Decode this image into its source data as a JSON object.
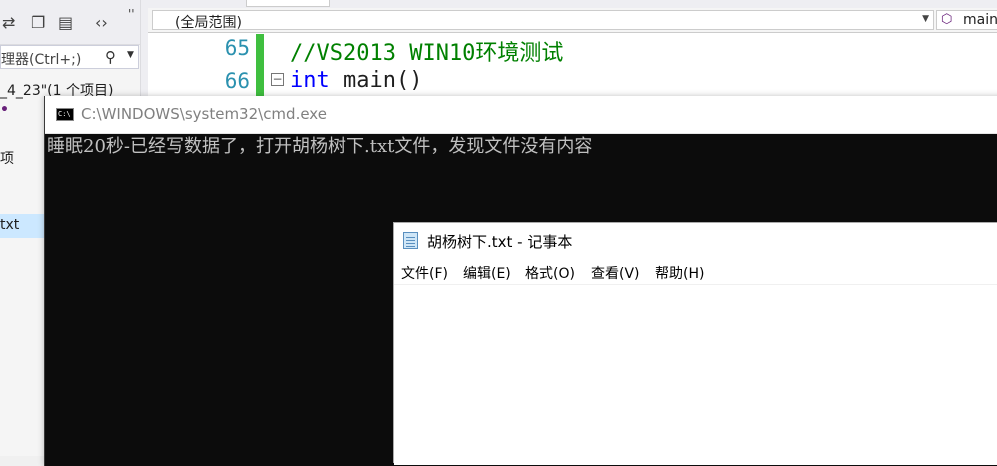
{
  "vs": {
    "toolbar_icons": [
      "sync-icon",
      "copy-icon",
      "properties-icon",
      "code-icon"
    ],
    "search_placeholder": "理器(Ctrl+;)",
    "solution_label": "_4_23\"(1 个项目)",
    "project_label": "项",
    "file_label": "txt",
    "scope_left": "(全局范围)",
    "scope_right": "main",
    "code_lines": [
      {
        "number": "65",
        "text": "//VS2013 WIN10环境测试"
      },
      {
        "number": "66",
        "keyword": "int",
        "text": " main()"
      }
    ]
  },
  "cmd": {
    "title": "C:\\WINDOWS\\system32\\cmd.exe",
    "output": "睡眠20秒-已经写数据了，打开胡杨树下.txt文件，发现文件没有内容"
  },
  "notepad": {
    "title": "胡杨树下.txt - 记事本",
    "menus": [
      "文件(F)",
      "编辑(E)",
      "格式(O)",
      "查看(V)",
      "帮助(H)"
    ],
    "content": ""
  },
  "colors": {
    "cmd_bg": "#0c0c0c",
    "cmd_text": "#c0c0c0",
    "keyword": "#0000ff",
    "comment": "#008000",
    "line_number": "#2b91af",
    "change_bar": "#3fbf3f"
  }
}
